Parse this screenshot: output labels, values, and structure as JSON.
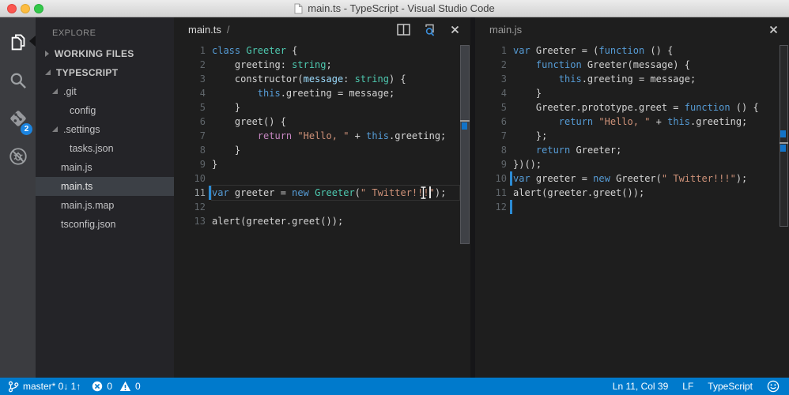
{
  "window": {
    "title": "main.ts - TypeScript - Visual Studio Code"
  },
  "activity_bar": {
    "items": [
      {
        "name": "explorer",
        "active": true
      },
      {
        "name": "search",
        "active": false
      },
      {
        "name": "git",
        "active": false,
        "badge": "2"
      },
      {
        "name": "debug",
        "active": false
      }
    ]
  },
  "sidebar": {
    "title": "EXPLORE",
    "items": [
      {
        "label": "WORKING FILES",
        "kind": "section",
        "arrow": "collapsed"
      },
      {
        "label": "TYPESCRIPT",
        "kind": "section",
        "arrow": "expanded"
      },
      {
        "label": ".git",
        "indent": 1,
        "arrow": "expanded"
      },
      {
        "label": "config",
        "indent": 2
      },
      {
        "label": ".settings",
        "indent": 1,
        "arrow": "expanded"
      },
      {
        "label": "tasks.json",
        "indent": 2
      },
      {
        "label": "main.js",
        "indent": 1
      },
      {
        "label": "main.ts",
        "indent": 1,
        "selected": true
      },
      {
        "label": "main.js.map",
        "indent": 1
      },
      {
        "label": "tsconfig.json",
        "indent": 1
      }
    ]
  },
  "editors": [
    {
      "title": "main.ts",
      "title_suffix": "/",
      "language": "typescript",
      "active": true,
      "actions": [
        "split-editor",
        "preview-search",
        "close"
      ],
      "current_line": 11,
      "lines": [
        [
          [
            "class",
            "k"
          ],
          [
            " ",
            "p"
          ],
          [
            "Greeter",
            "t"
          ],
          [
            " {",
            "p"
          ]
        ],
        [
          [
            "    greeting: ",
            "p"
          ],
          [
            "string",
            "t"
          ],
          [
            ";",
            "p"
          ]
        ],
        [
          [
            "    constructor(",
            "p"
          ],
          [
            "message",
            "v"
          ],
          [
            ": ",
            "p"
          ],
          [
            "string",
            "t"
          ],
          [
            ") {",
            "p"
          ]
        ],
        [
          [
            "        ",
            "p"
          ],
          [
            "this",
            "k"
          ],
          [
            ".greeting = message;",
            "p"
          ]
        ],
        [
          [
            "    }",
            "p"
          ]
        ],
        [
          [
            "    greet() {",
            "p"
          ]
        ],
        [
          [
            "        ",
            "p"
          ],
          [
            "return",
            "r"
          ],
          [
            " ",
            "p"
          ],
          [
            "\"Hello, \"",
            "s"
          ],
          [
            " + ",
            "p"
          ],
          [
            "this",
            "k"
          ],
          [
            ".greeting;",
            "p"
          ]
        ],
        [
          [
            "    }",
            "p"
          ]
        ],
        [
          [
            "}",
            "p"
          ]
        ],
        [],
        [
          [
            "",
            "bcaret"
          ],
          [
            "var",
            "k"
          ],
          [
            " greeter = ",
            "p"
          ],
          [
            "new",
            "k"
          ],
          [
            " ",
            "p"
          ],
          [
            "Greeter",
            "t"
          ],
          [
            "(",
            "p"
          ],
          [
            "\" Twitter!!!",
            "s"
          ],
          [
            "",
            "ibeam"
          ],
          [
            "",
            "caret"
          ],
          [
            "\"",
            "s"
          ],
          [
            ");",
            "p"
          ]
        ],
        [],
        [
          [
            "alert(greeter.greet());",
            "p"
          ]
        ]
      ]
    },
    {
      "title": "main.js",
      "title_suffix": "",
      "language": "javascript",
      "active": false,
      "actions": [
        "close"
      ],
      "current_line": 0,
      "lines": [
        [
          [
            "var",
            "k"
          ],
          [
            " Greeter = (",
            "p"
          ],
          [
            "function",
            "k"
          ],
          [
            " () {",
            "p"
          ]
        ],
        [
          [
            "    ",
            "p"
          ],
          [
            "function",
            "k"
          ],
          [
            " Greeter(message) {",
            "p"
          ]
        ],
        [
          [
            "        ",
            "p"
          ],
          [
            "this",
            "k"
          ],
          [
            ".greeting = message;",
            "p"
          ]
        ],
        [
          [
            "    }",
            "p"
          ]
        ],
        [
          [
            "    Greeter.prototype.greet = ",
            "p"
          ],
          [
            "function",
            "k"
          ],
          [
            " () {",
            "p"
          ]
        ],
        [
          [
            "        ",
            "p"
          ],
          [
            "return",
            "k"
          ],
          [
            " ",
            "p"
          ],
          [
            "\"Hello, \"",
            "s"
          ],
          [
            " + ",
            "p"
          ],
          [
            "this",
            "k"
          ],
          [
            ".greeting;",
            "p"
          ]
        ],
        [
          [
            "    };",
            "p"
          ]
        ],
        [
          [
            "    ",
            "p"
          ],
          [
            "return",
            "k"
          ],
          [
            " Greeter;",
            "p"
          ]
        ],
        [
          [
            "})();",
            "p"
          ]
        ],
        [
          [
            "",
            "bcaret"
          ],
          [
            "var",
            "k"
          ],
          [
            " greeter = ",
            "p"
          ],
          [
            "new",
            "k"
          ],
          [
            " Greeter(",
            "p"
          ],
          [
            "\" Twitter!!!\"",
            "s"
          ],
          [
            ");",
            "p"
          ]
        ],
        [
          [
            "alert(greeter.greet());",
            "p"
          ]
        ],
        [
          [
            "",
            "bcaret"
          ]
        ]
      ]
    }
  ],
  "status_bar": {
    "branch": "master* 0↓ 1↑",
    "errors": "0",
    "warnings": "0",
    "cursor_position": "Ln 11, Col 39",
    "eol": "LF",
    "language": "TypeScript"
  },
  "colors": {
    "accent": "#007ACC",
    "badge": "#1B84E0",
    "titlebar_top": "#ECECEC",
    "titlebar_bottom": "#D2D2D2",
    "activity_bar_bg": "#3B3C40",
    "sidebar_bg": "#242428",
    "selected_item_bg": "#3C4046",
    "editor_bg": "#1E1E1E",
    "keyword": "#569CD6",
    "type_name": "#4EC9B0",
    "string": "#CE9178",
    "parameter": "#9CDCFE",
    "return_keyword": "#C586C0",
    "plain_text": "#D4D4D4",
    "cursor_blue": "#2B8BD4"
  }
}
